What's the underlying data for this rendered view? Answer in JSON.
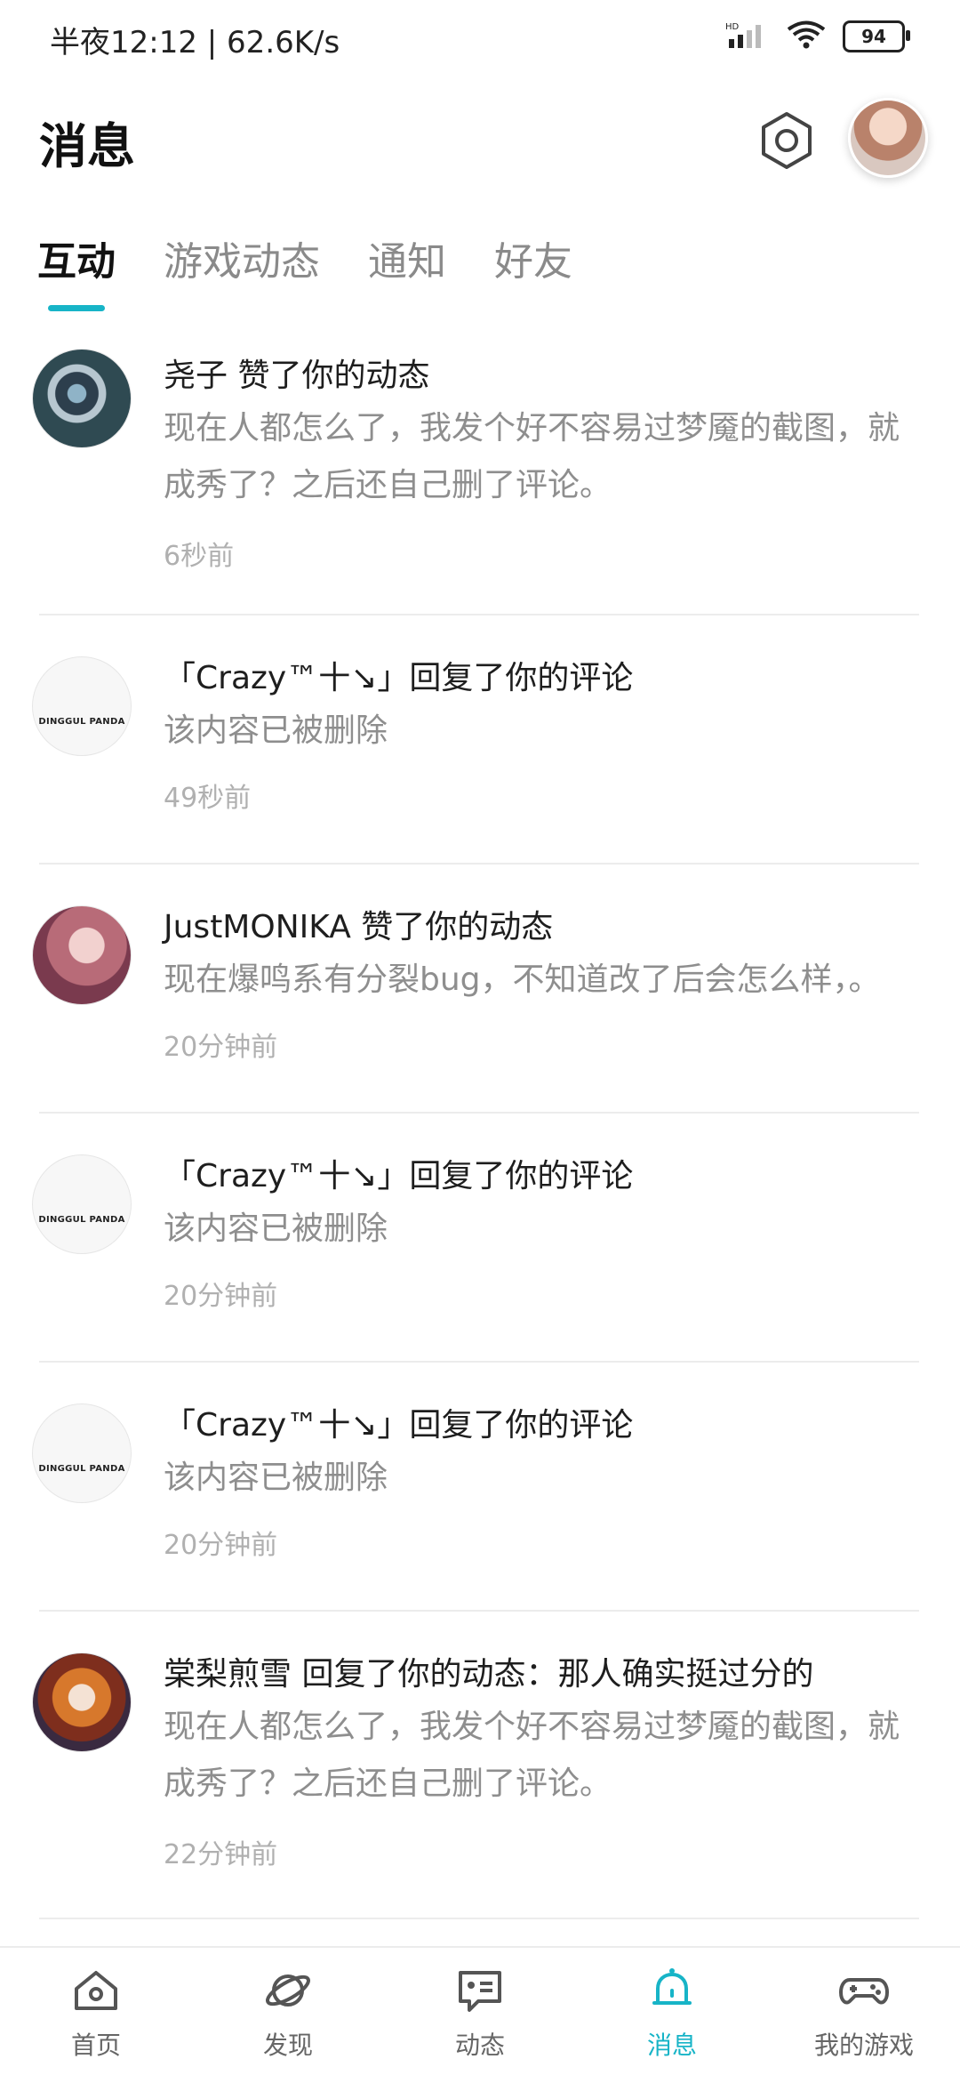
{
  "status_bar": {
    "left_text": "半夜12:12 | 62.6K/s",
    "network_label": "HD",
    "battery_level": "94"
  },
  "header": {
    "title": "消息"
  },
  "tabs": [
    {
      "label": "互动",
      "active": true
    },
    {
      "label": "游戏动态",
      "active": false
    },
    {
      "label": "通知",
      "active": false
    },
    {
      "label": "好友",
      "active": false
    }
  ],
  "messages": [
    {
      "line1": "尧子 赞了你的动态",
      "line2": "现在人都怎么了，我发个好不容易过梦魇的截图，就成秀了？之后还自己删了评论。",
      "time": "6秒前"
    },
    {
      "line1": "「Crazy™十↘」回复了你的评论",
      "line2": "该内容已被删除",
      "time": "49秒前"
    },
    {
      "line1": "JustMONIKA 赞了你的动态",
      "line2": "现在爆鸣系有分裂bug，不知道改了后会怎么样，。",
      "time": "20分钟前"
    },
    {
      "line1": "「Crazy™十↘」回复了你的评论",
      "line2": "该内容已被删除",
      "time": "20分钟前"
    },
    {
      "line1": "「Crazy™十↘」回复了你的评论",
      "line2": "该内容已被删除",
      "time": "20分钟前"
    },
    {
      "line1": "棠梨煎雪 回复了你的动态：那人确实挺过分的",
      "line2": "现在人都怎么了，我发个好不容易过梦魇的截图，就成秀了？之后还自己删了评论。",
      "time": "22分钟前"
    }
  ],
  "panda_avatar_text": "DINGGUL PANDA",
  "bottom_nav": [
    {
      "label": "首页",
      "icon": "home-icon",
      "active": false
    },
    {
      "label": "发现",
      "icon": "planet-icon",
      "active": false
    },
    {
      "label": "动态",
      "icon": "chat-icon",
      "active": false
    },
    {
      "label": "消息",
      "icon": "bell-icon",
      "active": true
    },
    {
      "label": "我的游戏",
      "icon": "gamepad-icon",
      "active": false
    }
  ],
  "colors": {
    "accent": "#17b4c7",
    "text": "#1e1e1e",
    "muted": "#8e8e8e",
    "time": "#b0b0b0"
  }
}
